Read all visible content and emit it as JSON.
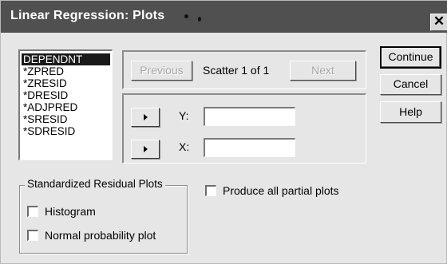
{
  "window": {
    "title": "Linear Regression: Plots"
  },
  "variables": [
    "DEPENDNT",
    "*ZPRED",
    "*ZRESID",
    "*DRESID",
    "*ADJPRED",
    "*SRESID",
    "*SDRESID"
  ],
  "scatter": {
    "previous_label": "Previous",
    "status": "Scatter 1 of 1",
    "next_label": "Next",
    "y_label": "Y:",
    "x_label": "X:",
    "y_value": "",
    "x_value": ""
  },
  "buttons": {
    "continue": "Continue",
    "cancel": "Cancel",
    "help": "Help"
  },
  "residual_group": {
    "title": "Standardized Residual Plots",
    "histogram": "Histogram",
    "normal_probability": "Normal probability plot"
  },
  "partial_plots": {
    "label": "Produce all partial plots"
  }
}
